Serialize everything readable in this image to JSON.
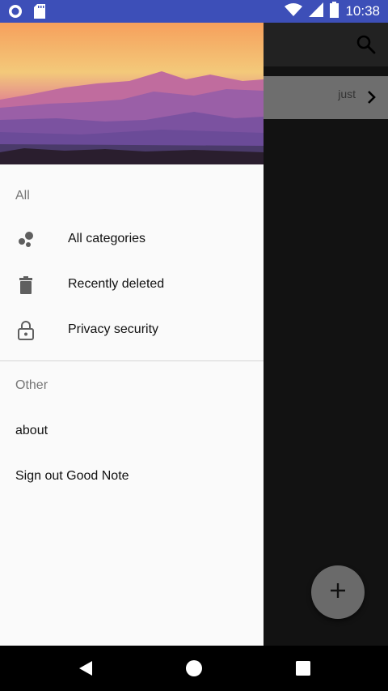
{
  "status_bar": {
    "time": "10:38",
    "icons": [
      "circle-app-icon",
      "sd-card-icon",
      "wifi-icon",
      "signal-icon",
      "battery-icon"
    ]
  },
  "background_app": {
    "note_time": "just",
    "fab_label": "+"
  },
  "drawer": {
    "section_all": "All",
    "items_all": [
      {
        "label": "All categories",
        "icon": "categories-icon"
      },
      {
        "label": "Recently deleted",
        "icon": "trash-icon"
      },
      {
        "label": "Privacy security",
        "icon": "lock-icon"
      }
    ],
    "section_other": "Other",
    "items_other": [
      {
        "label": "about"
      },
      {
        "label": "Sign out Good Note"
      }
    ]
  },
  "colors": {
    "status_bar": "#3d4fb8",
    "drawer_bg": "#fafafa",
    "scrim": "#121212"
  }
}
